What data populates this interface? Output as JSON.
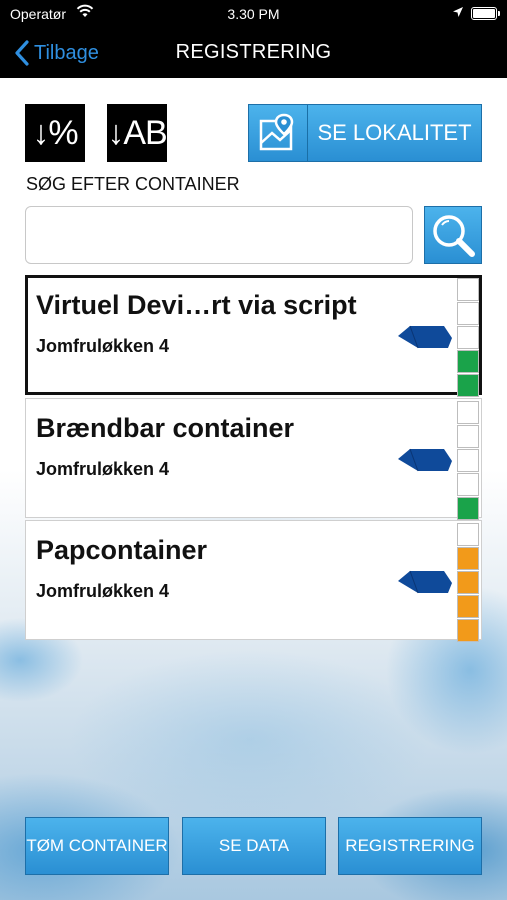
{
  "status_bar": {
    "carrier": "Operatør",
    "time": "3.30 PM"
  },
  "nav": {
    "back_label": "Tilbage",
    "title": "REGISTRERING",
    "accent": "#2f8fe0"
  },
  "toolbar": {
    "sort_percent_label": "↓%",
    "sort_alpha_label": "↓AB",
    "see_location_label": "SE LOKALITET"
  },
  "search": {
    "label": "SØG EFTER CONTAINER",
    "value": "",
    "placeholder": ""
  },
  "containers": [
    {
      "name": "Virtuel Devi…rt via script",
      "address": "Jomfruløkken 4",
      "selected": true,
      "fill_level": 2,
      "segments": 5,
      "fill_color": "#1aa34a"
    },
    {
      "name": "Brændbar container",
      "address": "Jomfruløkken 4",
      "selected": false,
      "fill_level": 1,
      "segments": 5,
      "fill_color": "#1aa34a"
    },
    {
      "name": "Papcontainer",
      "address": "Jomfruløkken 4",
      "selected": false,
      "fill_level": 4,
      "segments": 5,
      "fill_color": "#f29a1a"
    }
  ],
  "bottom_buttons": {
    "empty": "TØM CONTAINER",
    "data": "SE DATA",
    "register": "REGISTRERING"
  },
  "colors": {
    "button_blue": "#3aa3e3",
    "skip_blue": "#0f4a9a"
  }
}
